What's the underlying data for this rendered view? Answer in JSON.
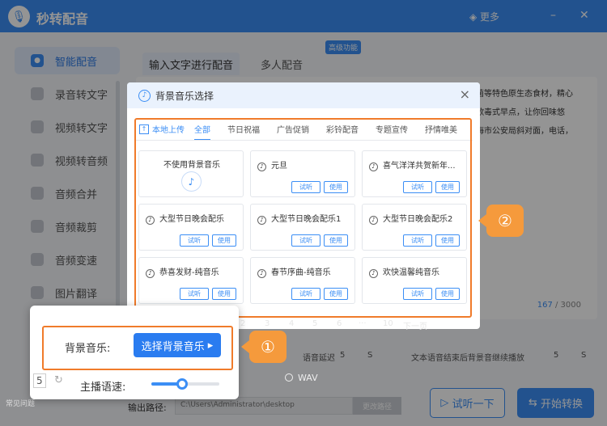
{
  "app": {
    "title": "秒转配音",
    "more_label": "更多",
    "minimize": "–",
    "close": "✕",
    "logo_icon": "mic-icon"
  },
  "sidebar": {
    "items": [
      {
        "label": "智能配音",
        "active": true
      },
      {
        "label": "录音转文字"
      },
      {
        "label": "视频转文字"
      },
      {
        "label": "视频转音频"
      },
      {
        "label": "音频合并"
      },
      {
        "label": "音频裁剪"
      },
      {
        "label": "音频变速"
      },
      {
        "label": "图片翻译"
      }
    ],
    "help_label": "常见问题"
  },
  "main": {
    "tabs": [
      {
        "label": "输入文字进行配音",
        "active": true
      },
      {
        "label": "多人配音"
      }
    ],
    "advanced_tag": "高级功能",
    "editor_lines": [
      "菌等特色原生态食材，精心",
      "歌毒式早点，让你回味悠",
      "海市公安局斜对面，电话，"
    ],
    "count_current": "167",
    "count_max": "/ 3000",
    "bg_delay_label": "语音延迟",
    "bg_delay_value": "5",
    "bg_delay_unit": "S",
    "bg_continue_label": "文本语音结束后背景音继续播放",
    "bg_continue_value": "5",
    "bg_continue_unit": "S",
    "wav_label": "WAV",
    "output_label": "输出路径:",
    "output_path": "C:\\Users\\Administrator\\desktop",
    "change_path": "更改路径",
    "try_label": "试听一下",
    "start_label": "开始转换"
  },
  "dialog": {
    "title": "背景音乐选择",
    "close": "×",
    "upload_label": "本地上传",
    "categories": [
      "全部",
      "节日祝福",
      "广告促销",
      "彩铃配音",
      "专题宣传",
      "抒情唯美"
    ],
    "active_category": "全部",
    "no_music_label": "不使用背景音乐",
    "tracks": [
      {
        "title": "元旦"
      },
      {
        "title": "喜气洋洋共贺新年..."
      },
      {
        "title": "大型节日晚会配乐"
      },
      {
        "title": "大型节日晚会配乐1"
      },
      {
        "title": "大型节日晚会配乐2"
      },
      {
        "title": "恭喜发财-纯音乐"
      },
      {
        "title": "春节序曲-纯音乐"
      },
      {
        "title": "欢快温馨纯音乐"
      }
    ],
    "listen_label": "试听",
    "use_label": "使用",
    "pages": [
      "2",
      "3",
      "4",
      "5",
      "6",
      "···",
      "10",
      "下一页"
    ]
  },
  "popup": {
    "bg_music_label": "背景音乐:",
    "select_button": "选择背景音乐",
    "speed_label": "主播语速:",
    "speed_value": "5",
    "speed_level": 0.45
  },
  "badges": {
    "one": "①",
    "two": "②"
  },
  "colors": {
    "accent": "#3b8ef5",
    "highlight": "#f07b2a",
    "badge": "#f59a3c"
  }
}
